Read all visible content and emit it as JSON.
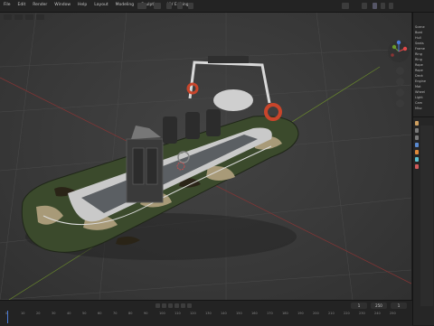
{
  "menu": [
    "File",
    "Edit",
    "Render",
    "Window",
    "Help",
    "Layout",
    "Modeling",
    "Sculpting",
    "UV Editing"
  ],
  "timeline": {
    "ruler": [
      "0",
      "10",
      "20",
      "30",
      "40",
      "50",
      "60",
      "70",
      "80",
      "90",
      "100",
      "110",
      "120",
      "130",
      "140",
      "150",
      "160",
      "170",
      "180",
      "190",
      "200",
      "210",
      "220",
      "230",
      "240",
      "250"
    ],
    "start": "1",
    "end": "250",
    "current": "1"
  },
  "outliner": {
    "rows": [
      "Scene",
      "Boat",
      "Hull",
      "Seats",
      "Frame",
      "Ring",
      "Ring",
      "Rope",
      "Rope",
      "Deck",
      "Engine",
      "Mat",
      "Wheel",
      "Light",
      "Cam",
      "Misc"
    ]
  },
  "colors": {
    "accent_orange": "#e08a3a",
    "viewport_bg": "#393939",
    "camo_green": "#3b4a2c",
    "camo_tan": "#a89a78",
    "ring_red": "#c8452b"
  }
}
